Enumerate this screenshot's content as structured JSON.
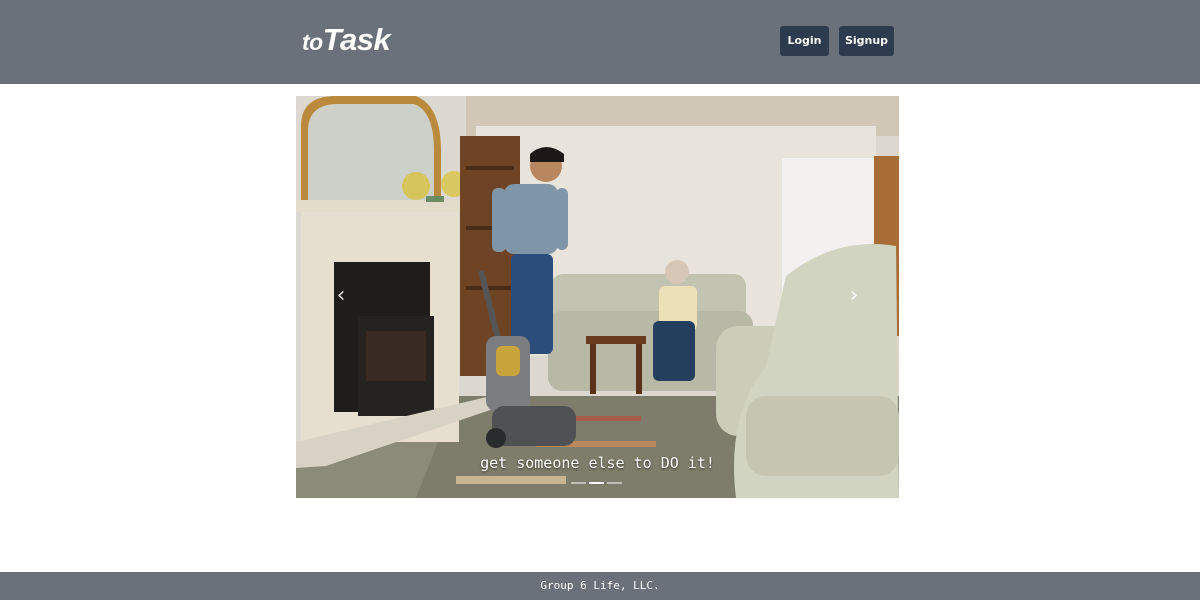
{
  "header": {
    "brand_prefix": "to",
    "brand_main": "Task",
    "login_label": "Login",
    "signup_label": "Signup"
  },
  "carousel": {
    "caption": "get someone else to DO it!",
    "slide_count": 3,
    "active_index": 1,
    "prev_symbol": "‹",
    "next_symbol": "›",
    "image_subject": "photo"
  },
  "footer": {
    "text": "Group 6 Life, LLC."
  },
  "colors": {
    "navbar": "#6b717b",
    "button": "#2e3b4e",
    "footer": "#6b717b"
  }
}
